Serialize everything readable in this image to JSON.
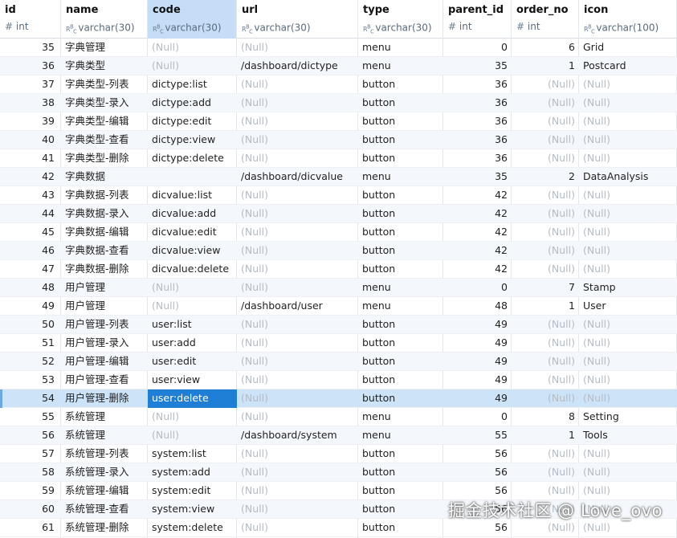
{
  "columns": [
    {
      "name": "id",
      "type": "int",
      "icon": "hash-icon"
    },
    {
      "name": "name",
      "type": "varchar(30)",
      "icon": "abc-icon"
    },
    {
      "name": "code",
      "type": "varchar(30)",
      "icon": "abc-icon"
    },
    {
      "name": "url",
      "type": "varchar(30)",
      "icon": "abc-icon"
    },
    {
      "name": "type",
      "type": "varchar(30)",
      "icon": "abc-icon"
    },
    {
      "name": "parent_id",
      "type": "int",
      "icon": "hash-icon"
    },
    {
      "name": "order_no",
      "type": "int",
      "icon": "hash-icon"
    },
    {
      "name": "icon",
      "type": "varchar(100)",
      "icon": "abc-icon"
    }
  ],
  "selected_column": "code",
  "selected_row_id": "54",
  "null_text": "(Null)",
  "rows": [
    [
      "35",
      "字典管理",
      "(Null)",
      "(Null)",
      "menu",
      "0",
      "6",
      "Grid"
    ],
    [
      "36",
      "字典类型",
      "(Null)",
      "/dashboard/dictype",
      "menu",
      "35",
      "1",
      "Postcard"
    ],
    [
      "37",
      "字典类型-列表",
      "dictype:list",
      "(Null)",
      "button",
      "36",
      "(Null)",
      "(Null)"
    ],
    [
      "38",
      "字典类型-录入",
      "dictype:add",
      "(Null)",
      "button",
      "36",
      "(Null)",
      "(Null)"
    ],
    [
      "39",
      "字典类型-编辑",
      "dictype:edit",
      "(Null)",
      "button",
      "36",
      "(Null)",
      "(Null)"
    ],
    [
      "40",
      "字典类型-查看",
      "dictype:view",
      "(Null)",
      "button",
      "36",
      "(Null)",
      "(Null)"
    ],
    [
      "41",
      "字典类型-删除",
      "dictype:delete",
      "(Null)",
      "button",
      "36",
      "(Null)",
      "(Null)"
    ],
    [
      "42",
      "字典数据",
      "",
      "/dashboard/dicvalue",
      "menu",
      "35",
      "2",
      "DataAnalysis"
    ],
    [
      "43",
      "字典数据-列表",
      "dicvalue:list",
      "(Null)",
      "button",
      "42",
      "(Null)",
      "(Null)"
    ],
    [
      "44",
      "字典数据-录入",
      "dicvalue:add",
      "(Null)",
      "button",
      "42",
      "(Null)",
      "(Null)"
    ],
    [
      "45",
      "字典数据-编辑",
      "dicvalue:edit",
      "(Null)",
      "button",
      "42",
      "(Null)",
      "(Null)"
    ],
    [
      "46",
      "字典数据-查看",
      "dicvalue:view",
      "(Null)",
      "button",
      "42",
      "(Null)",
      "(Null)"
    ],
    [
      "47",
      "字典数据-删除",
      "dicvalue:delete",
      "(Null)",
      "button",
      "42",
      "(Null)",
      "(Null)"
    ],
    [
      "48",
      "用户管理",
      "(Null)",
      "(Null)",
      "menu",
      "0",
      "7",
      "Stamp"
    ],
    [
      "49",
      "用户管理",
      "(Null)",
      "/dashboard/user",
      "menu",
      "48",
      "1",
      "User"
    ],
    [
      "50",
      "用户管理-列表",
      "user:list",
      "(Null)",
      "button",
      "49",
      "(Null)",
      "(Null)"
    ],
    [
      "51",
      "用户管理-录入",
      "user:add",
      "(Null)",
      "button",
      "49",
      "(Null)",
      "(Null)"
    ],
    [
      "52",
      "用户管理-编辑",
      "user:edit",
      "(Null)",
      "button",
      "49",
      "(Null)",
      "(Null)"
    ],
    [
      "53",
      "用户管理-查看",
      "user:view",
      "(Null)",
      "button",
      "49",
      "(Null)",
      "(Null)"
    ],
    [
      "54",
      "用户管理-删除",
      "user:delete",
      "(Null)",
      "button",
      "49",
      "(Null)",
      "(Null)"
    ],
    [
      "55",
      "系统管理",
      "(Null)",
      "(Null)",
      "menu",
      "0",
      "8",
      "Setting"
    ],
    [
      "56",
      "系统管理",
      "(Null)",
      "/dashboard/system",
      "menu",
      "55",
      "1",
      "Tools"
    ],
    [
      "57",
      "系统管理-列表",
      "system:list",
      "(Null)",
      "button",
      "56",
      "(Null)",
      "(Null)"
    ],
    [
      "58",
      "系统管理-录入",
      "system:add",
      "(Null)",
      "button",
      "56",
      "(Null)",
      "(Null)"
    ],
    [
      "59",
      "系统管理-编辑",
      "system:edit",
      "(Null)",
      "button",
      "56",
      "(Null)",
      "(Null)"
    ],
    [
      "60",
      "系统管理-查看",
      "system:view",
      "(Null)",
      "button",
      "56",
      "(Null)",
      "(Null)"
    ],
    [
      "61",
      "系统管理-删除",
      "system:delete",
      "(Null)",
      "button",
      "56",
      "(Null)",
      "(Null)"
    ]
  ],
  "watermark": "掘金技术社区 @ Love_ovo"
}
